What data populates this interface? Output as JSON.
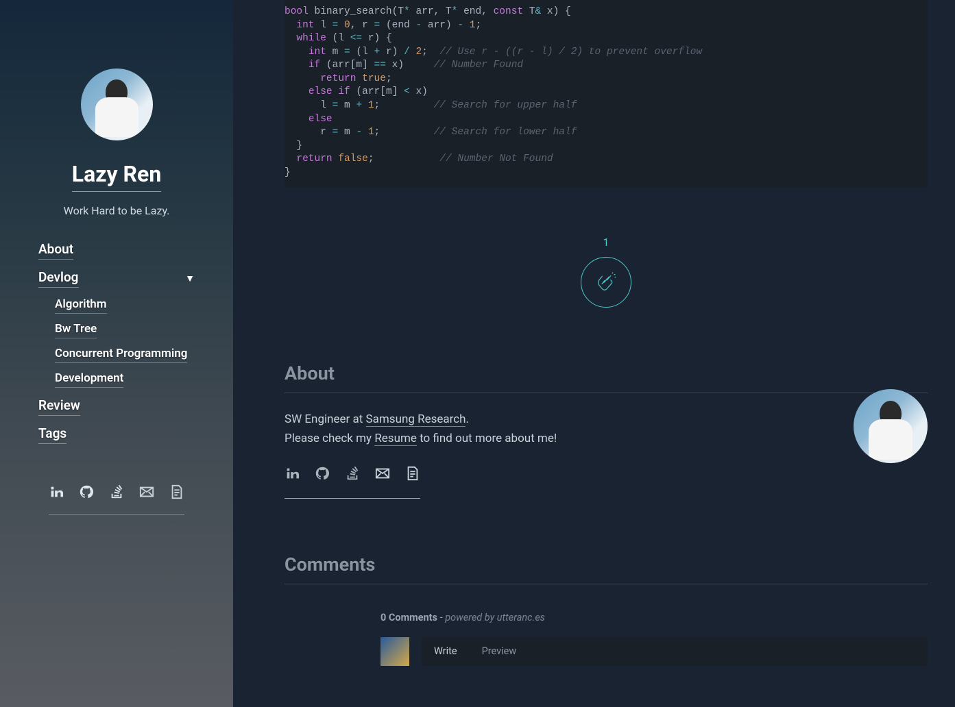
{
  "sidebar": {
    "title": "Lazy Ren",
    "tagline": "Work Hard to be Lazy.",
    "nav": [
      {
        "label": "About"
      },
      {
        "label": "Devlog",
        "children": [
          {
            "label": "Algorithm"
          },
          {
            "label": "Bw Tree"
          },
          {
            "label": "Concurrent Programming"
          },
          {
            "label": "Development"
          }
        ]
      },
      {
        "label": "Review"
      },
      {
        "label": "Tags"
      }
    ]
  },
  "code": {
    "lines": [
      [
        {
          "t": "bool",
          "c": "kw"
        },
        {
          "t": " binary_search(T",
          "c": "plain"
        },
        {
          "t": "*",
          "c": "op"
        },
        {
          "t": " arr, T",
          "c": "plain"
        },
        {
          "t": "*",
          "c": "op"
        },
        {
          "t": " end, ",
          "c": "plain"
        },
        {
          "t": "const",
          "c": "kw"
        },
        {
          "t": " T",
          "c": "plain"
        },
        {
          "t": "&",
          "c": "op"
        },
        {
          "t": " x) {",
          "c": "plain"
        }
      ],
      [
        {
          "t": "  ",
          "c": "plain"
        },
        {
          "t": "int",
          "c": "kw"
        },
        {
          "t": " l ",
          "c": "plain"
        },
        {
          "t": "=",
          "c": "op"
        },
        {
          "t": " ",
          "c": "plain"
        },
        {
          "t": "0",
          "c": "num"
        },
        {
          "t": ", r ",
          "c": "plain"
        },
        {
          "t": "=",
          "c": "op"
        },
        {
          "t": " (end ",
          "c": "plain"
        },
        {
          "t": "-",
          "c": "op"
        },
        {
          "t": " arr) ",
          "c": "plain"
        },
        {
          "t": "-",
          "c": "op"
        },
        {
          "t": " ",
          "c": "plain"
        },
        {
          "t": "1",
          "c": "num"
        },
        {
          "t": ";",
          "c": "plain"
        }
      ],
      [
        {
          "t": "  ",
          "c": "plain"
        },
        {
          "t": "while",
          "c": "kw"
        },
        {
          "t": " (l ",
          "c": "plain"
        },
        {
          "t": "<=",
          "c": "op"
        },
        {
          "t": " r) {",
          "c": "plain"
        }
      ],
      [
        {
          "t": "    ",
          "c": "plain"
        },
        {
          "t": "int",
          "c": "kw"
        },
        {
          "t": " m ",
          "c": "plain"
        },
        {
          "t": "=",
          "c": "op"
        },
        {
          "t": " (l ",
          "c": "plain"
        },
        {
          "t": "+",
          "c": "op"
        },
        {
          "t": " r) ",
          "c": "plain"
        },
        {
          "t": "/",
          "c": "op"
        },
        {
          "t": " ",
          "c": "plain"
        },
        {
          "t": "2",
          "c": "num"
        },
        {
          "t": ";  ",
          "c": "plain"
        },
        {
          "t": "// Use r - ((r - l) / 2) to prevent overflow",
          "c": "comment"
        }
      ],
      [
        {
          "t": "    ",
          "c": "plain"
        },
        {
          "t": "if",
          "c": "kw"
        },
        {
          "t": " (arr[m] ",
          "c": "plain"
        },
        {
          "t": "==",
          "c": "op"
        },
        {
          "t": " x)     ",
          "c": "plain"
        },
        {
          "t": "// Number Found",
          "c": "comment"
        }
      ],
      [
        {
          "t": "      ",
          "c": "plain"
        },
        {
          "t": "return",
          "c": "kw"
        },
        {
          "t": " ",
          "c": "plain"
        },
        {
          "t": "true",
          "c": "bool"
        },
        {
          "t": ";",
          "c": "plain"
        }
      ],
      [
        {
          "t": "    ",
          "c": "plain"
        },
        {
          "t": "else",
          "c": "kw"
        },
        {
          "t": " ",
          "c": "plain"
        },
        {
          "t": "if",
          "c": "kw"
        },
        {
          "t": " (arr[m] ",
          "c": "plain"
        },
        {
          "t": "<",
          "c": "op"
        },
        {
          "t": " x)",
          "c": "plain"
        }
      ],
      [
        {
          "t": "      l ",
          "c": "plain"
        },
        {
          "t": "=",
          "c": "op"
        },
        {
          "t": " m ",
          "c": "plain"
        },
        {
          "t": "+",
          "c": "op"
        },
        {
          "t": " ",
          "c": "plain"
        },
        {
          "t": "1",
          "c": "num"
        },
        {
          "t": ";         ",
          "c": "plain"
        },
        {
          "t": "// Search for upper half",
          "c": "comment"
        }
      ],
      [
        {
          "t": "    ",
          "c": "plain"
        },
        {
          "t": "else",
          "c": "kw"
        }
      ],
      [
        {
          "t": "      r ",
          "c": "plain"
        },
        {
          "t": "=",
          "c": "op"
        },
        {
          "t": " m ",
          "c": "plain"
        },
        {
          "t": "-",
          "c": "op"
        },
        {
          "t": " ",
          "c": "plain"
        },
        {
          "t": "1",
          "c": "num"
        },
        {
          "t": ";         ",
          "c": "plain"
        },
        {
          "t": "// Search for lower half",
          "c": "comment"
        }
      ],
      [
        {
          "t": "  }",
          "c": "plain"
        }
      ],
      [
        {
          "t": "  ",
          "c": "plain"
        },
        {
          "t": "return",
          "c": "kw"
        },
        {
          "t": " ",
          "c": "plain"
        },
        {
          "t": "false",
          "c": "bool"
        },
        {
          "t": ";           ",
          "c": "plain"
        },
        {
          "t": "// Number Not Found",
          "c": "comment"
        }
      ],
      [
        {
          "t": "}",
          "c": "plain"
        }
      ]
    ]
  },
  "applause": {
    "count": "1"
  },
  "about": {
    "heading": "About",
    "line1_pre": "SW Engineer at ",
    "line1_link": "Samsung Research",
    "line1_post": ".",
    "line2_pre": "Please check my ",
    "line2_link": "Resume",
    "line2_post": " to find out more about me!"
  },
  "comments": {
    "heading": "Comments",
    "count_label": "0 Comments",
    "sep": " - ",
    "powered": "powered by utteranc.es",
    "tabs": {
      "write": "Write",
      "preview": "Preview"
    }
  },
  "social_icons": [
    "linkedin",
    "github",
    "stackoverflow",
    "email",
    "resume"
  ]
}
